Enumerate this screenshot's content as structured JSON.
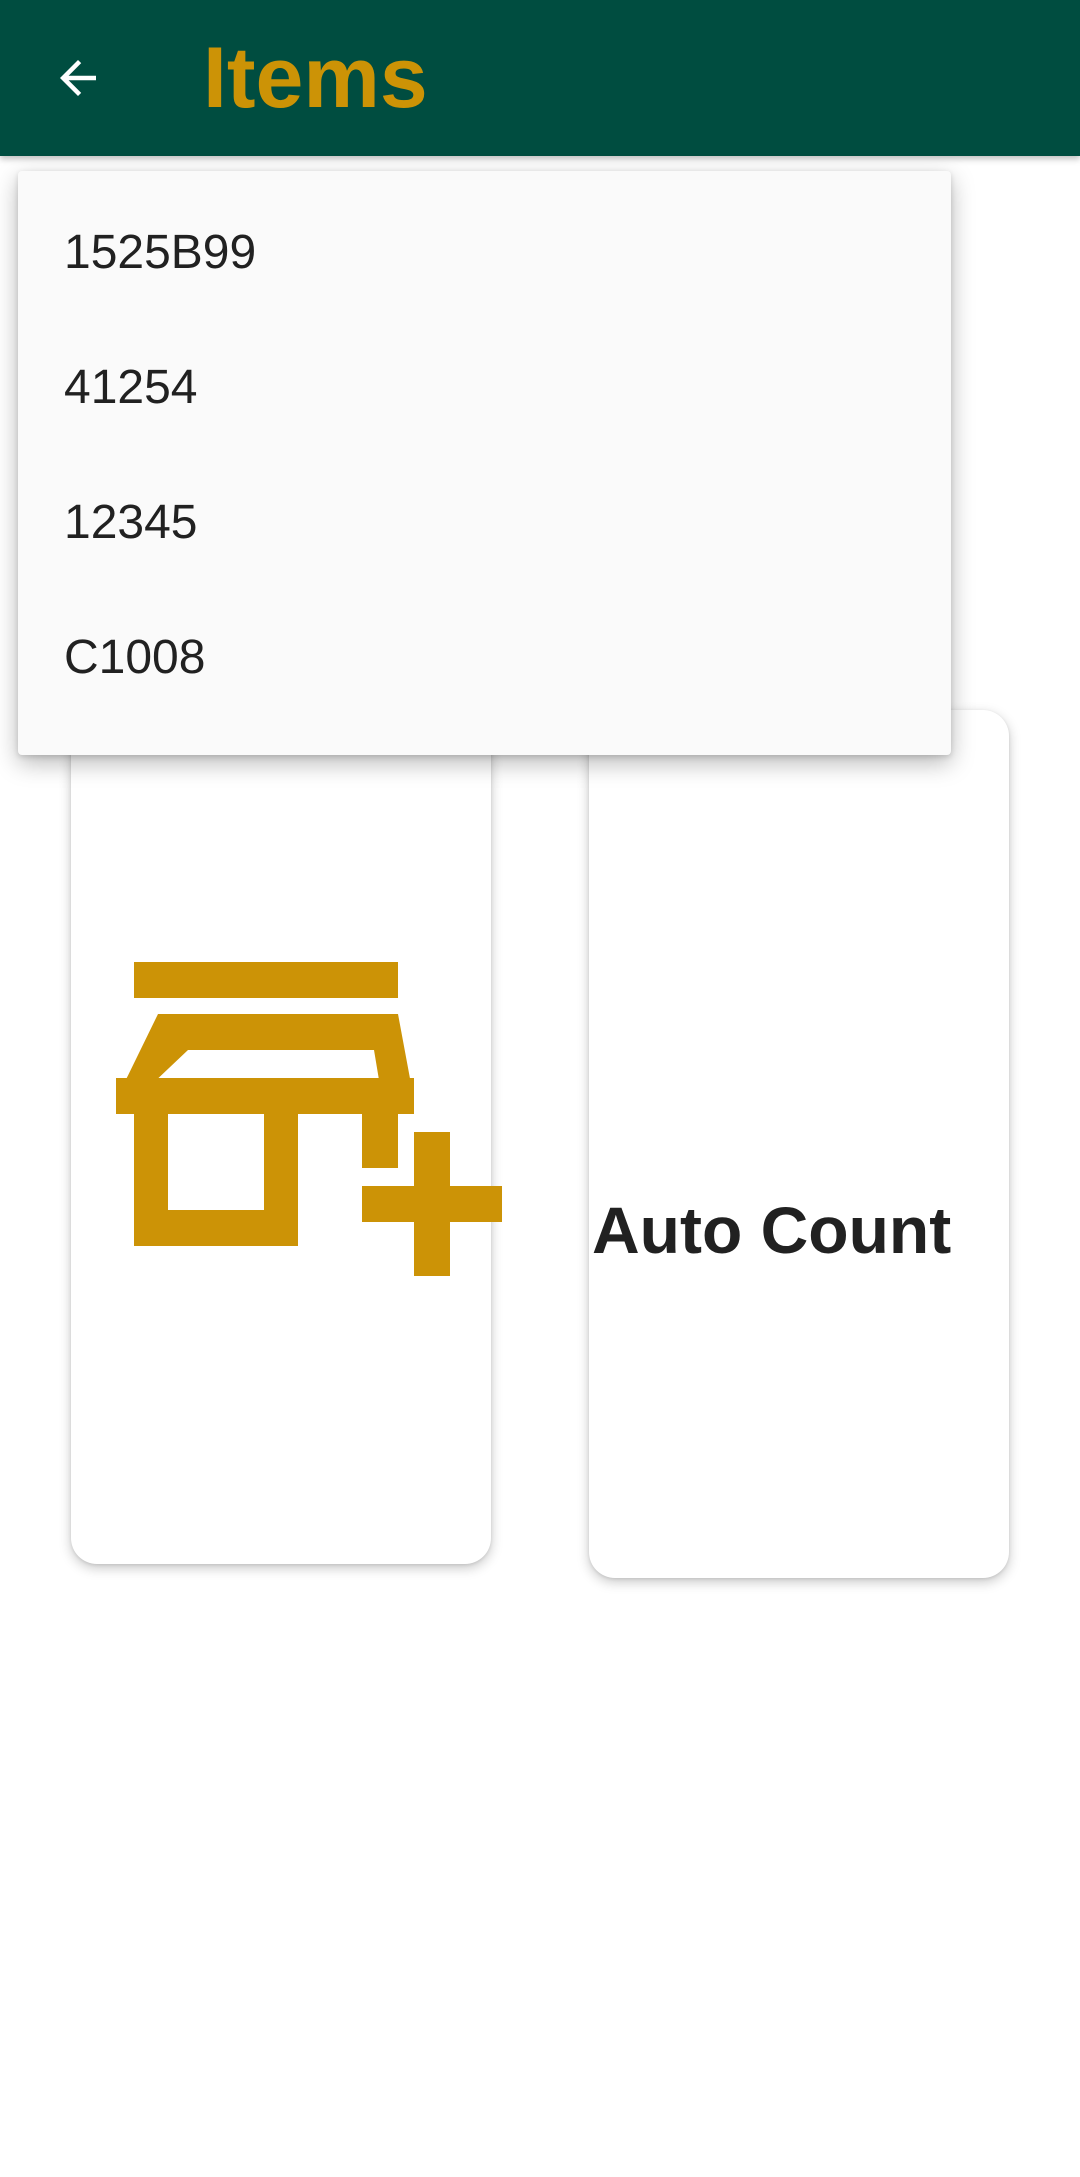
{
  "app_bar": {
    "title": "Items",
    "back_icon": "arrow-left-icon",
    "background_color": "#004d40",
    "title_color": "#cc9306"
  },
  "dropdown": {
    "options": [
      "1525B99",
      "41254",
      "12345",
      "C1008"
    ]
  },
  "cards": {
    "left": {
      "icon": "store-add-icon",
      "icon_color": "#cc9306"
    },
    "right": {
      "label": "Auto Count"
    }
  }
}
